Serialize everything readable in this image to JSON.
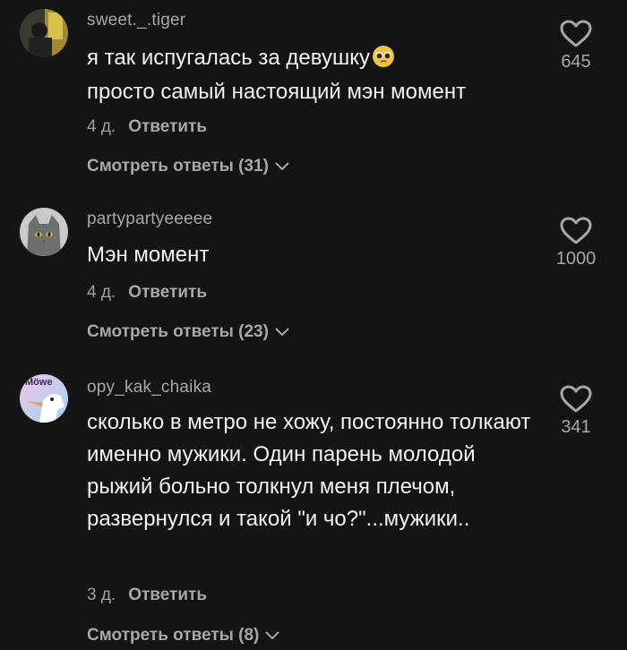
{
  "comments": [
    {
      "username": "sweet._.tiger",
      "text": "я так испугалась за девушку",
      "text2": "просто самый настоящий мэн момент",
      "emoji": "pleading-face-emoji",
      "time": "4 д.",
      "reply": "Ответить",
      "view_replies": "Смотреть ответы (31)",
      "likes": "645"
    },
    {
      "username": "partypartyeeeee",
      "text": "Мэн момент",
      "time": "4 д.",
      "reply": "Ответить",
      "view_replies": "Смотреть ответы (23)",
      "likes": "1000"
    },
    {
      "username": "opy_kak_chaika",
      "avatar_text": "Möwe",
      "text": "сколько в метро не хожу, постоянно толкают именно мужики. Один парень молодой рыжий больно толкнул меня плечом, развернулся и такой \"и чо?\"...мужики..",
      "time": "3 д.",
      "reply": "Ответить",
      "view_replies": "Смотреть ответы (8)",
      "likes": "341"
    }
  ],
  "icons": {
    "like": "heart-outline-icon",
    "expand": "chevron-down-icon"
  }
}
